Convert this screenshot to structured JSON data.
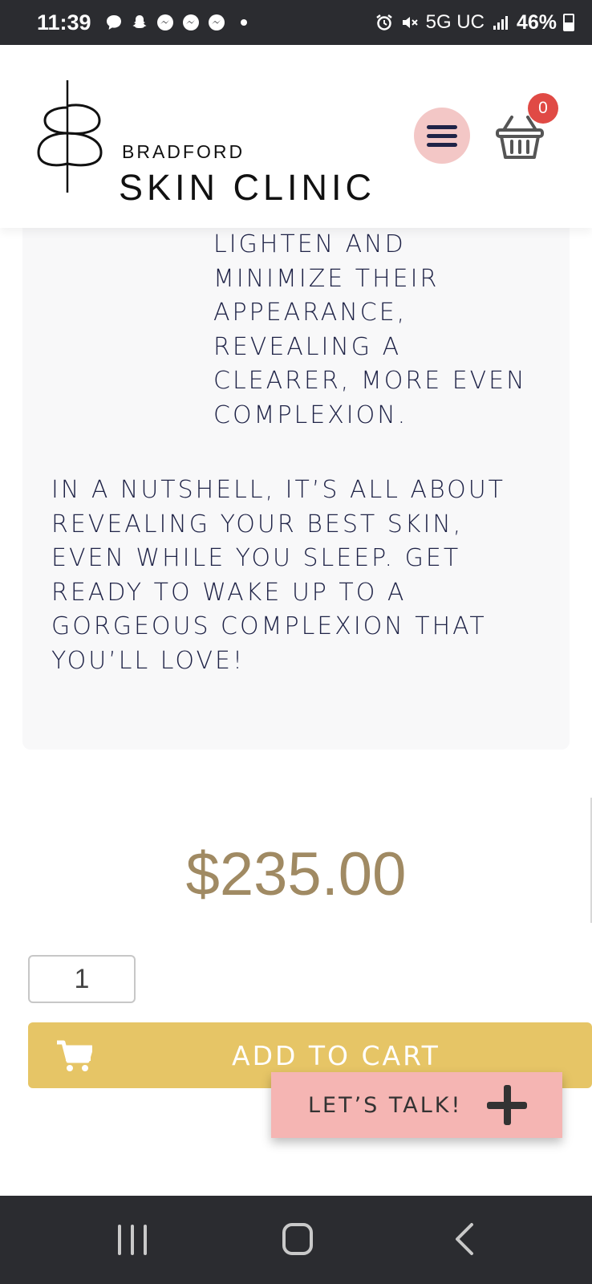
{
  "status_bar": {
    "time": "11:39",
    "notification_icons": [
      "chat-bubble-icon",
      "snapchat-icon",
      "messenger-icon",
      "messenger-icon",
      "messenger-icon"
    ],
    "network": "5G UC",
    "battery": "46%"
  },
  "header": {
    "brand_line1": "BRADFORD",
    "brand_line2": "SKIN CLINIC",
    "cart_count": "0",
    "colors": {
      "menu_bg": "#f3c7c6",
      "badge": "#e04a45"
    }
  },
  "content": {
    "list_item_lines": [
      "LIGHTEN AND",
      "MINIMIZE THEIR",
      "APPEARANCE,",
      "REVEALING A",
      "CLEARER, MORE EVEN",
      "COMPLEXION."
    ],
    "nutshell_lines": [
      "IN A NUTSHELL, IT’S ALL ABOUT",
      "REVEALING YOUR BEST SKIN,",
      "EVEN WHILE YOU SLEEP. GET",
      "READY TO WAKE UP TO A",
      "GORGEOUS COMPLEXION THAT",
      "YOU’LL LOVE!"
    ]
  },
  "product": {
    "price": "$235.00",
    "quantity": "1",
    "add_to_cart_label": "ADD TO CART",
    "colors": {
      "price": "#a08a63",
      "add_to_cart": "#e6c566"
    }
  },
  "chat_widget": {
    "label": "LET’S TALK!",
    "color": "#f5b5b3"
  },
  "nav_bar": {
    "icons": [
      "recent-apps-icon",
      "home-icon",
      "back-icon"
    ]
  }
}
